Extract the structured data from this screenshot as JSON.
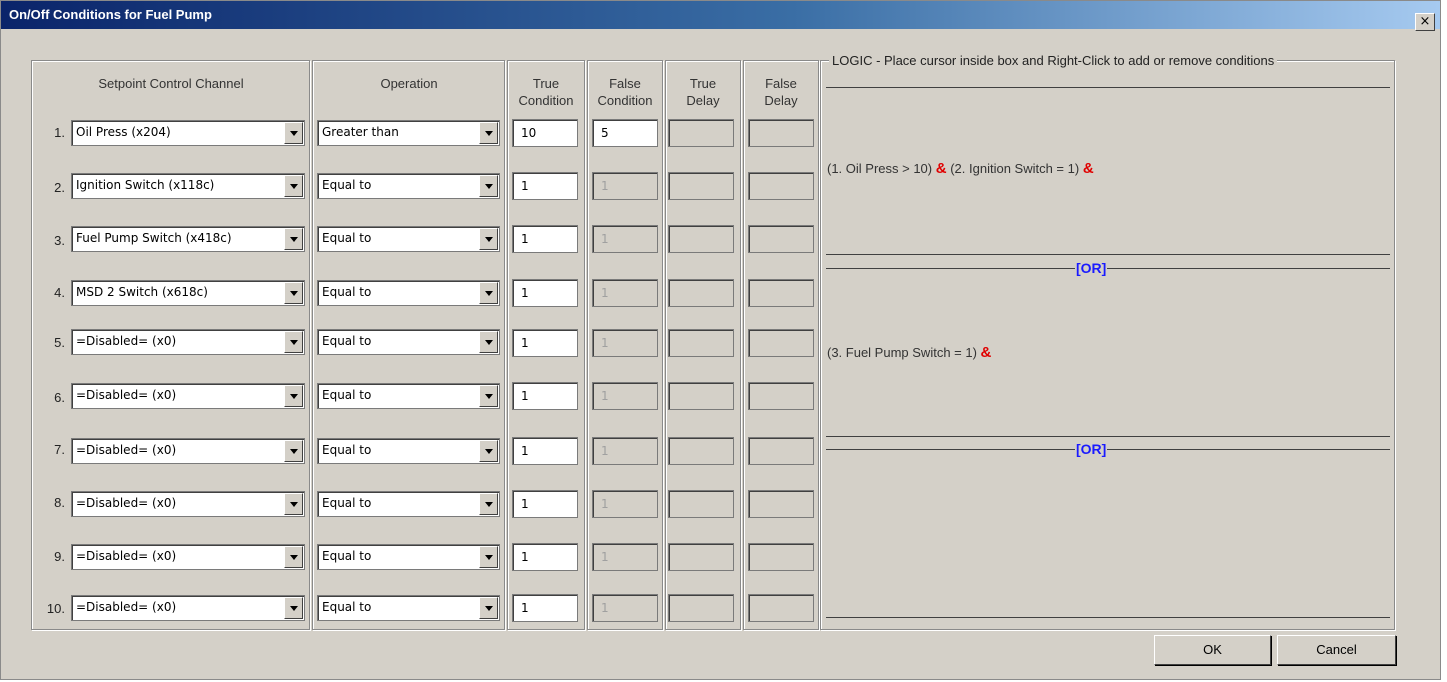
{
  "window": {
    "title": "On/Off Conditions for Fuel Pump",
    "close_label": "×"
  },
  "headers": {
    "channel": "Setpoint Control Channel",
    "operation": "Operation",
    "true_condition": [
      "True",
      "Condition"
    ],
    "false_condition": [
      "False",
      "Condition"
    ],
    "true_delay": [
      "True",
      "Delay"
    ],
    "false_delay": [
      "False",
      "Delay"
    ]
  },
  "rows": [
    {
      "num": "1.",
      "channel": "Oil Press (x204)",
      "operation": "Greater than",
      "true_value": "10",
      "false_value": "5",
      "false_enabled": true
    },
    {
      "num": "2.",
      "channel": "Ignition Switch (x118c)",
      "operation": "Equal to",
      "true_value": "1",
      "false_value": "1",
      "false_enabled": false
    },
    {
      "num": "3.",
      "channel": "Fuel Pump Switch (x418c)",
      "operation": "Equal to",
      "true_value": "1",
      "false_value": "1",
      "false_enabled": false
    },
    {
      "num": "4.",
      "channel": "MSD 2 Switch (x618c)",
      "operation": "Equal to",
      "true_value": "1",
      "false_value": "1",
      "false_enabled": false
    },
    {
      "num": "5.",
      "channel": "=Disabled= (x0)",
      "operation": "Equal to",
      "true_value": "1",
      "false_value": "1",
      "false_enabled": false
    },
    {
      "num": "6.",
      "channel": "=Disabled= (x0)",
      "operation": "Equal to",
      "true_value": "1",
      "false_value": "1",
      "false_enabled": false
    },
    {
      "num": "7.",
      "channel": "=Disabled= (x0)",
      "operation": "Equal to",
      "true_value": "1",
      "false_value": "1",
      "false_enabled": false
    },
    {
      "num": "8.",
      "channel": "=Disabled= (x0)",
      "operation": "Equal to",
      "true_value": "1",
      "false_value": "1",
      "false_enabled": false
    },
    {
      "num": "9.",
      "channel": "=Disabled= (x0)",
      "operation": "Equal to",
      "true_value": "1",
      "false_value": "1",
      "false_enabled": false
    },
    {
      "num": "10.",
      "channel": "=Disabled= (x0)",
      "operation": "Equal to",
      "true_value": "1",
      "false_value": "1",
      "false_enabled": false
    }
  ],
  "logic": {
    "legend": "LOGIC - Place cursor inside box and Right-Click to add or remove conditions",
    "groups": [
      {
        "terms": [
          "(1. Oil Press > 10)",
          "(2. Ignition Switch = 1)"
        ]
      },
      {
        "terms": [
          "(3. Fuel Pump Switch = 1)"
        ]
      }
    ],
    "and_symbol": "&",
    "or_label": "[OR]"
  },
  "buttons": {
    "ok": "OK",
    "cancel": "Cancel"
  },
  "colors": {
    "titlebar": "#0a246a",
    "and_symbol": "#e00000",
    "or_label": "#1a1aff",
    "dialog_bg": "#d4d0c8"
  }
}
